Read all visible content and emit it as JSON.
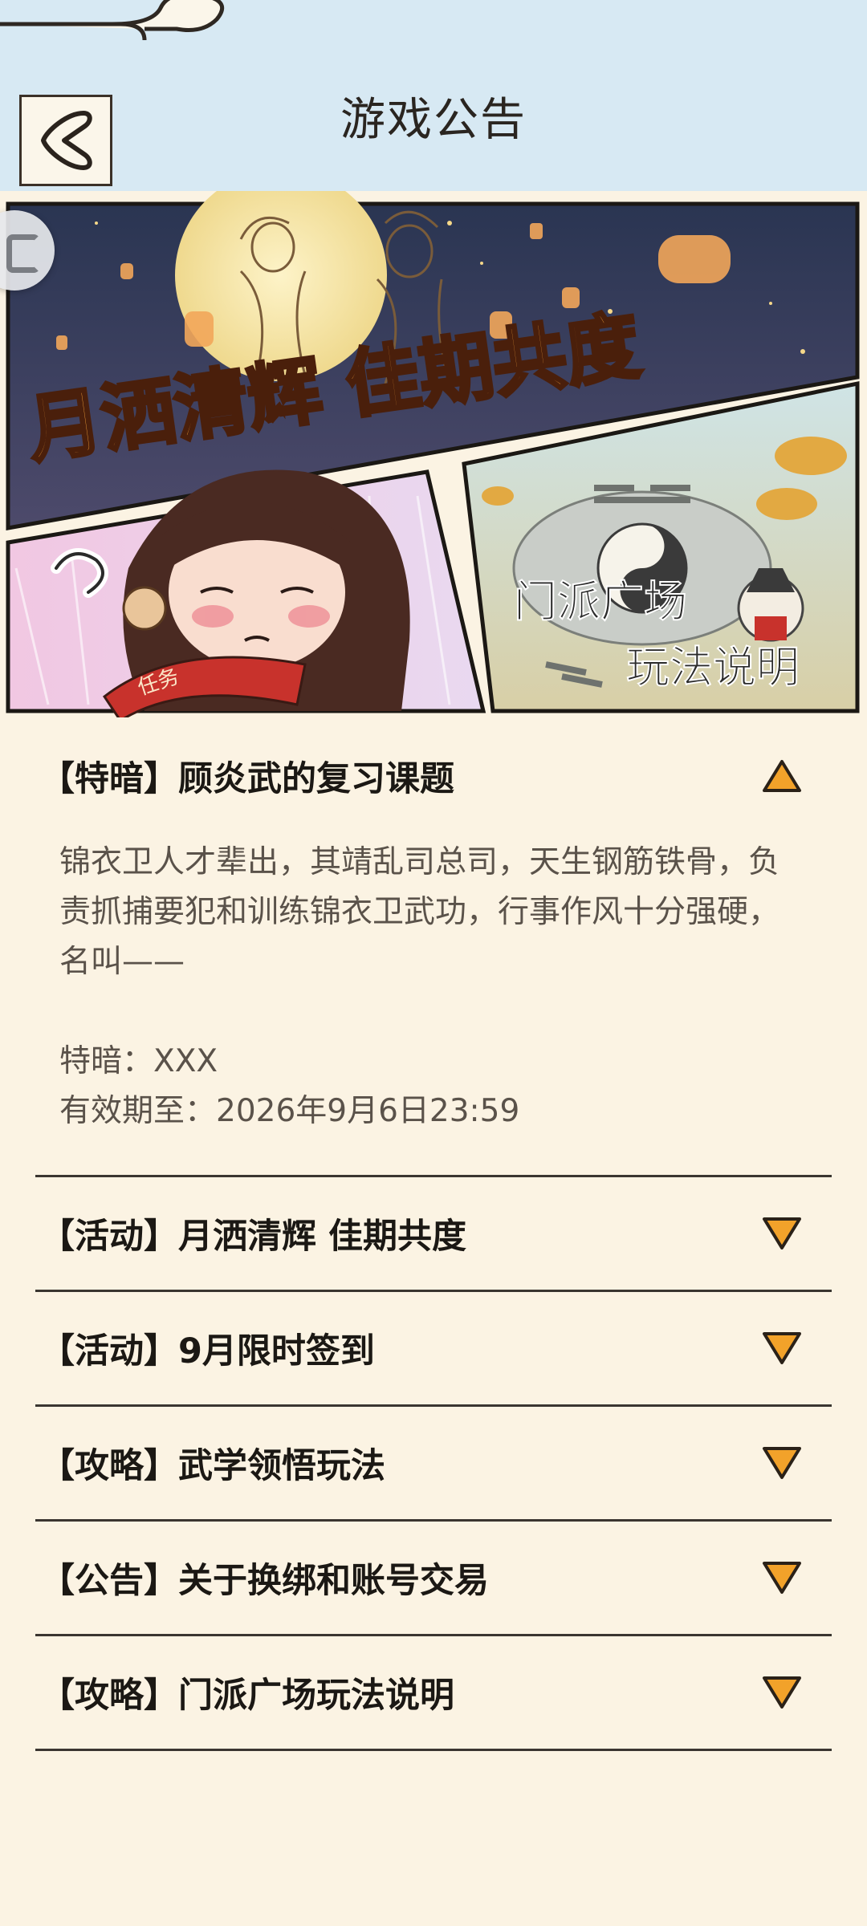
{
  "header": {
    "title": "游戏公告",
    "back_icon": "back-arrow-icon"
  },
  "banner": {
    "title_text": "月洒清辉 佳期共度",
    "scroll_text": "任务",
    "plaza_line1": "门派广场",
    "plaza_line2": "玩法说明"
  },
  "notices": [
    {
      "title": "【特暗】顾炎武的复习课题",
      "expanded": true,
      "arrow": "triangle-up-icon",
      "body": {
        "paragraph": "锦衣卫人才辈出，其靖乱司总司，天生钢筋铁骨，负责抓捕要犯和训练锦衣卫武功，行事作风十分强硬，名叫——",
        "answer_line": "特暗：XXX",
        "expiry_line": "有效期至：2026年9月6日23:59"
      }
    },
    {
      "title": "【活动】月洒清辉 佳期共度",
      "expanded": false,
      "arrow": "triangle-down-icon"
    },
    {
      "title": "【活动】9月限时签到",
      "expanded": false,
      "arrow": "triangle-down-icon"
    },
    {
      "title": "【攻略】武学领悟玩法",
      "expanded": false,
      "arrow": "triangle-down-icon"
    },
    {
      "title": "【公告】关于换绑和账号交易",
      "expanded": false,
      "arrow": "triangle-down-icon"
    },
    {
      "title": "【攻略】门派广场玩法说明",
      "expanded": false,
      "arrow": "triangle-down-icon"
    }
  ],
  "colors": {
    "background": "#fbf3e3",
    "header_bg": "#d7e9f3",
    "arrow_fill": "#f2a22a",
    "divider": "#3a3530"
  }
}
